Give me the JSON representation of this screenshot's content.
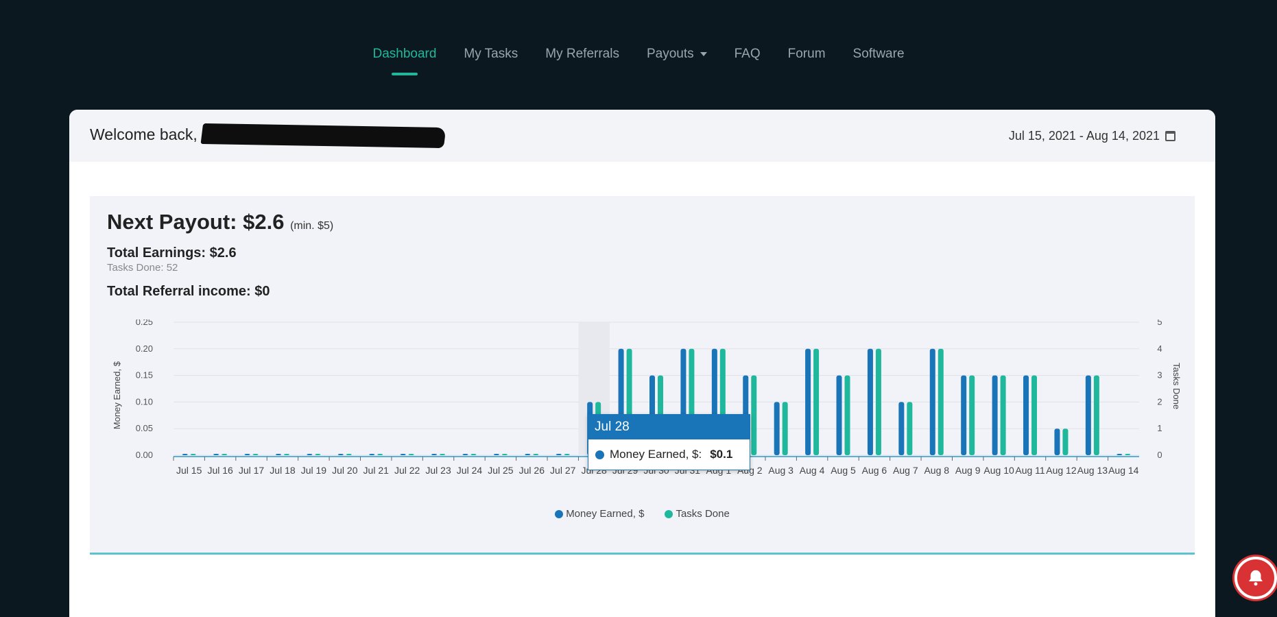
{
  "nav": {
    "items": [
      {
        "label": "Dashboard",
        "active": true
      },
      {
        "label": "My Tasks"
      },
      {
        "label": "My Referrals"
      },
      {
        "label": "Payouts",
        "has_caret": true
      },
      {
        "label": "FAQ"
      },
      {
        "label": "Forum"
      },
      {
        "label": "Software"
      }
    ]
  },
  "header": {
    "welcome_text": "Welcome back,",
    "date_range": "Jul 15, 2021 - Aug 14, 2021"
  },
  "summary": {
    "next_payout_label": "Next Payout: $2.6",
    "next_payout_min": "(min. $5)",
    "total_earnings": "Total Earnings: $2.6",
    "tasks_done": "Tasks Done: 52",
    "referral_income": "Total Referral income: $0"
  },
  "tooltip": {
    "date": "Jul 28",
    "label": "Money Earned, $:",
    "value": "$0.1"
  },
  "colors": {
    "accent": "#1fb89c",
    "money": "#1a74b8",
    "tasks": "#1fb89c"
  },
  "chart_data": {
    "type": "bar",
    "categories": [
      "Jul 15",
      "Jul 16",
      "Jul 17",
      "Jul 18",
      "Jul 19",
      "Jul 20",
      "Jul 21",
      "Jul 22",
      "Jul 23",
      "Jul 24",
      "Jul 25",
      "Jul 26",
      "Jul 27",
      "Jul 28",
      "Jul 29",
      "Jul 30",
      "Jul 31",
      "Aug 1",
      "Aug 2",
      "Aug 3",
      "Aug 4",
      "Aug 5",
      "Aug 6",
      "Aug 7",
      "Aug 8",
      "Aug 9",
      "Aug 10",
      "Aug 11",
      "Aug 12",
      "Aug 13",
      "Aug 14"
    ],
    "series": [
      {
        "name": "Money Earned, $",
        "axis": "left",
        "values": [
          0,
          0,
          0,
          0,
          0,
          0,
          0,
          0,
          0,
          0,
          0,
          0,
          0,
          0.1,
          0.2,
          0.15,
          0.2,
          0.2,
          0.15,
          0.1,
          0.2,
          0.15,
          0.2,
          0.1,
          0.2,
          0.15,
          0.15,
          0.15,
          0.05,
          0.15,
          0
        ]
      },
      {
        "name": "Tasks Done",
        "axis": "right",
        "values": [
          0,
          0,
          0,
          0,
          0,
          0,
          0,
          0,
          0,
          0,
          0,
          0,
          0,
          2,
          4,
          3,
          4,
          4,
          3,
          2,
          4,
          3,
          4,
          2,
          4,
          3,
          3,
          3,
          1,
          3,
          0
        ]
      }
    ],
    "ylabel": "Money Earned, $",
    "ylabel_right": "Tasks Done",
    "ylim": [
      0,
      0.25
    ],
    "ylim_right": [
      0,
      5
    ],
    "yticks": [
      "0.00",
      "0.05",
      "0.10",
      "0.15",
      "0.20",
      "0.25"
    ],
    "yticks_right": [
      "0",
      "1",
      "2",
      "3",
      "4",
      "5"
    ],
    "grid": true,
    "legend": "bottom-center"
  }
}
